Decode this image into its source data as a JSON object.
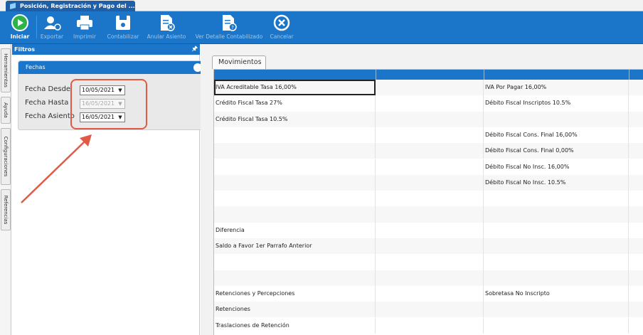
{
  "window": {
    "tab_title": "Posición, Registración y Pago del ..."
  },
  "toolbar": {
    "buttons": [
      {
        "label": "Iniciar",
        "icon": "play-icon",
        "enabled": true
      },
      {
        "label": "Exportar",
        "icon": "add-user-icon",
        "enabled": false
      },
      {
        "label": "Imprimir",
        "icon": "printer-icon",
        "enabled": false
      },
      {
        "label": "Contabilizar",
        "icon": "save-icon",
        "enabled": false
      },
      {
        "label": "Anular Asiento",
        "icon": "cancel-document-icon",
        "enabled": false
      },
      {
        "label": "Ver Detalle Contabilizado",
        "icon": "help-document-icon",
        "enabled": false
      },
      {
        "label": "Cancelar",
        "icon": "close-circle-icon",
        "enabled": false
      }
    ]
  },
  "side_tabs": [
    "Herramientas",
    "Ayuda",
    "Configuraciones",
    "Referencias"
  ],
  "filter_panel": {
    "title": "Filtros",
    "pin_icon": "pin-icon",
    "group_title": "Fechas",
    "fields": [
      {
        "label": "Fecha Desde",
        "value": "10/05/2021",
        "enabled": true
      },
      {
        "label": "Fecha Hasta",
        "value": "16/05/2021",
        "enabled": false
      },
      {
        "label": "Fecha Asiento",
        "value": "16/05/2021",
        "enabled": true
      }
    ]
  },
  "colors": {
    "accent": "#1b75c9",
    "annotation": "#e15a46"
  },
  "movimientos": {
    "tab_label": "Movimientos",
    "rows": [
      {
        "left": "IVA Acreditable Tasa 16,00%",
        "right": "IVA Por Pagar 16,00%"
      },
      {
        "left": "Crédito Fiscal Tasa 27%",
        "right": "Débito Fiscal Inscriptos 10.5%"
      },
      {
        "left": "Crédito Fiscal Tasa 10.5%",
        "right": ""
      },
      {
        "left": "",
        "right": "Débito Fiscal Cons. Final 16,00%"
      },
      {
        "left": "",
        "right": "Débito Fiscal Cons. Final 0,00%"
      },
      {
        "left": "",
        "right": "Débito Fiscal No Insc. 16,00%"
      },
      {
        "left": "",
        "right": "Débito Fiscal No Insc. 10.5%"
      },
      {
        "left": "",
        "right": ""
      },
      {
        "left": "",
        "right": ""
      },
      {
        "left": "Diferencia",
        "right": ""
      },
      {
        "left": "Saldo a Favor 1er Parrafo Anterior",
        "right": ""
      },
      {
        "left": "",
        "right": ""
      },
      {
        "left": "",
        "right": ""
      },
      {
        "left": "Retenciones y Percepciones",
        "right": "Sobretasa No Inscripto"
      },
      {
        "left": "Retenciones",
        "right": ""
      },
      {
        "left": "Traslaciones de Retención",
        "right": ""
      }
    ]
  }
}
